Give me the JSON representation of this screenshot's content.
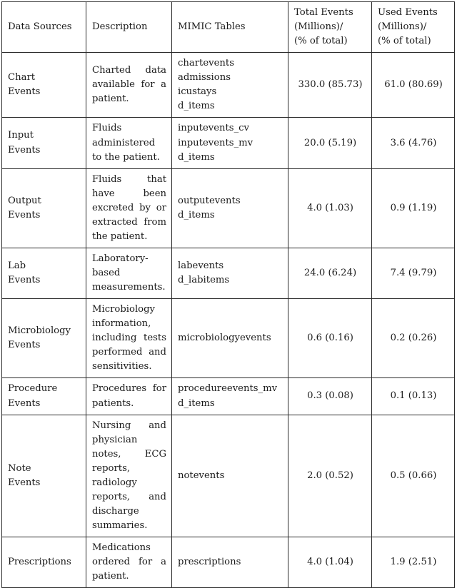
{
  "table": {
    "columns": [
      {
        "key": "data_sources",
        "header_lines": [
          "Data Sources"
        ]
      },
      {
        "key": "description",
        "header_lines": [
          "Description"
        ]
      },
      {
        "key": "mimic_tables",
        "header_lines": [
          "MIMIC Tables"
        ]
      },
      {
        "key": "total_events",
        "header_lines": [
          "Total Events",
          "(Millions)/",
          "(% of total)"
        ]
      },
      {
        "key": "used_events",
        "header_lines": [
          "Used Events",
          "(Millions)/",
          "(% of total)"
        ]
      }
    ],
    "rows": [
      {
        "source_line1": "Chart",
        "source_line2": "Events",
        "description": "Charted data available for a patient.",
        "mimic_tables": "chartevents\nadmissions\nicustays\nd_items",
        "total_events": "330.0 (85.73)",
        "used_events": "61.0 (80.69)"
      },
      {
        "source_line1": "Input",
        "source_line2": "Events",
        "description": "Fluids administered to the patient.",
        "mimic_tables": "inputevents_cv\ninputevents_mv\nd_items",
        "total_events": "20.0 (5.19)",
        "used_events": "3.6 (4.76)"
      },
      {
        "source_line1": "Output",
        "source_line2": "Events",
        "description": "Fluids that have been excreted by or extracted from the patient.",
        "mimic_tables": "outputevents\nd_items",
        "total_events": "4.0 (1.03)",
        "used_events": "0.9 (1.19)"
      },
      {
        "source_line1": "Lab",
        "source_line2": "Events",
        "description": "Laboratory-based measurements.",
        "mimic_tables": "labevents\nd_labitems",
        "total_events": "24.0 (6.24)",
        "used_events": "7.4 (9.79)"
      },
      {
        "source_line1": "Microbiology",
        "source_line2": "Events",
        "description": "Microbiology information, including tests performed and sensitivities.",
        "mimic_tables": "microbiologyevents",
        "total_events": "0.6 (0.16)",
        "used_events": "0.2 (0.26)"
      },
      {
        "source_line1": "Procedure",
        "source_line2": "Events",
        "description": "Procedures for patients.",
        "mimic_tables": "procedureevents_mv\nd_items",
        "total_events": "0.3 (0.08)",
        "used_events": "0.1 (0.13)"
      },
      {
        "source_line1": "Note",
        "source_line2": "Events",
        "description": "Nursing and physician notes, ECG reports, radiology reports, and discharge summaries.",
        "mimic_tables": "notevents",
        "total_events": "2.0 (0.52)",
        "used_events": "0.5 (0.66)"
      },
      {
        "source_line1": "Prescriptions",
        "source_line2": "",
        "description": "Medications ordered for a patient.",
        "mimic_tables": "prescriptions",
        "total_events": "4.0 (1.04)",
        "used_events": "1.9 (2.51)"
      }
    ]
  }
}
